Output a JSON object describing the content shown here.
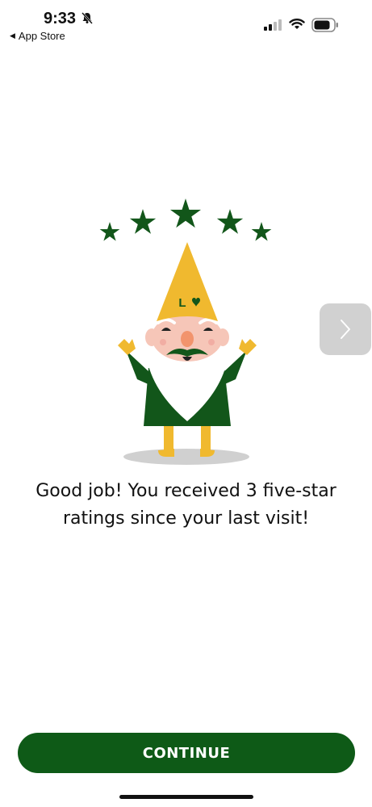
{
  "status_bar": {
    "time": "9:33",
    "back_label": "App Store",
    "icons": [
      "bell-slash-icon",
      "signal-icon",
      "wifi-icon",
      "battery-icon"
    ]
  },
  "illustration": {
    "stars_count": 5,
    "hat_badge": "L"
  },
  "message": {
    "line1": "Good job! You received 3 five-star",
    "line2": "ratings since your last visit!"
  },
  "continue_label": "CONTINUE",
  "colors": {
    "primary_green": "#0e5a17",
    "star_green": "#12561a",
    "hat_yellow": "#f0b92f",
    "shadow_gray": "#d0d0d0"
  }
}
